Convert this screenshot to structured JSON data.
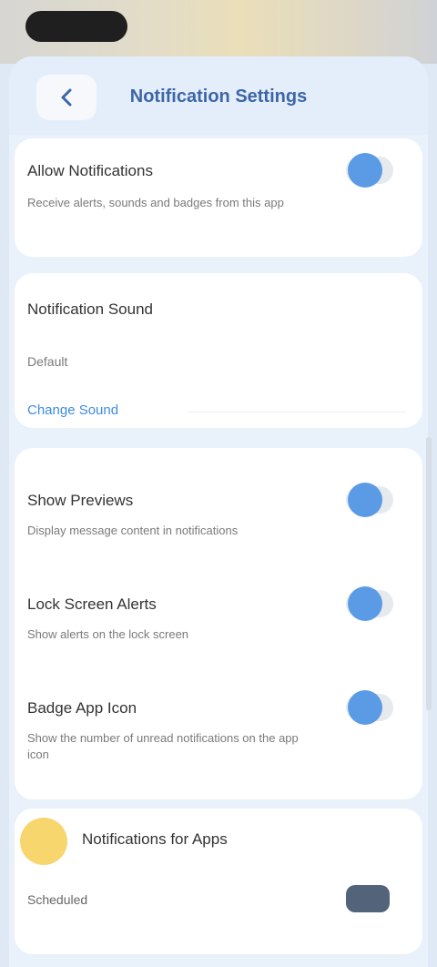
{
  "status_bar": {
    "time": "",
    "right": ""
  },
  "header": {
    "title": "Notification Settings",
    "back_icon": "chevron-left-icon"
  },
  "settings": {
    "allow_notifications": {
      "title": "Allow Notifications",
      "desc": "Receive alerts, sounds and badges from this app",
      "enabled": true
    },
    "notification_sound": {
      "title": "Notification Sound",
      "value": "Default",
      "link": "Change Sound"
    },
    "show_previews": {
      "title": "Show Previews",
      "desc": "Display message content in notifications",
      "enabled": true
    },
    "lock_screen": {
      "title": "Lock Screen Alerts",
      "desc": "Show alerts on the lock screen",
      "enabled": true
    },
    "badge_app_icon": {
      "title": "Badge App Icon",
      "desc": "Show the number of unread notifications on the app icon",
      "enabled": true
    }
  },
  "app_row": {
    "name": "Notifications for Apps",
    "label": "Scheduled",
    "avatar_color": "#f7d66d"
  },
  "colors": {
    "accent": "#5b9be6",
    "title": "#3d66a8",
    "link": "#3d8be6"
  }
}
